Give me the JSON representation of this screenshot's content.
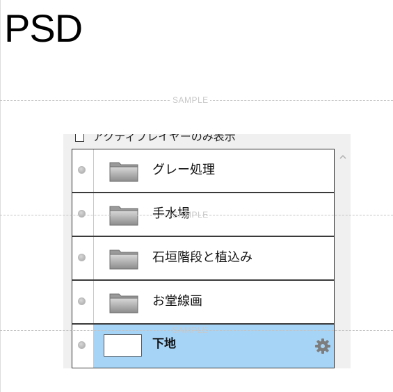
{
  "page": {
    "title": "PSD"
  },
  "watermark": {
    "text": "SAMPLE"
  },
  "panel": {
    "active_only_label": "アクティブレイヤーのみ表示",
    "active_only_checked": false,
    "scroll_up_icon": "chevron-up-icon",
    "layers": [
      {
        "name": "グレー処理",
        "kind": "folder",
        "icon": "folder-icon"
      },
      {
        "name": "手水場",
        "kind": "folder",
        "icon": "folder-icon"
      },
      {
        "name": "石垣階段と植込み",
        "kind": "folder",
        "icon": "folder-icon"
      },
      {
        "name": "お堂線画",
        "kind": "folder",
        "icon": "folder-icon"
      },
      {
        "name": "下地",
        "kind": "layer",
        "selected": true,
        "icon": "gear-icon"
      }
    ]
  },
  "colors": {
    "selected_row": "#a6d4f7",
    "panel_bg": "#f0f0f0",
    "gear": "#7d7d7d"
  }
}
